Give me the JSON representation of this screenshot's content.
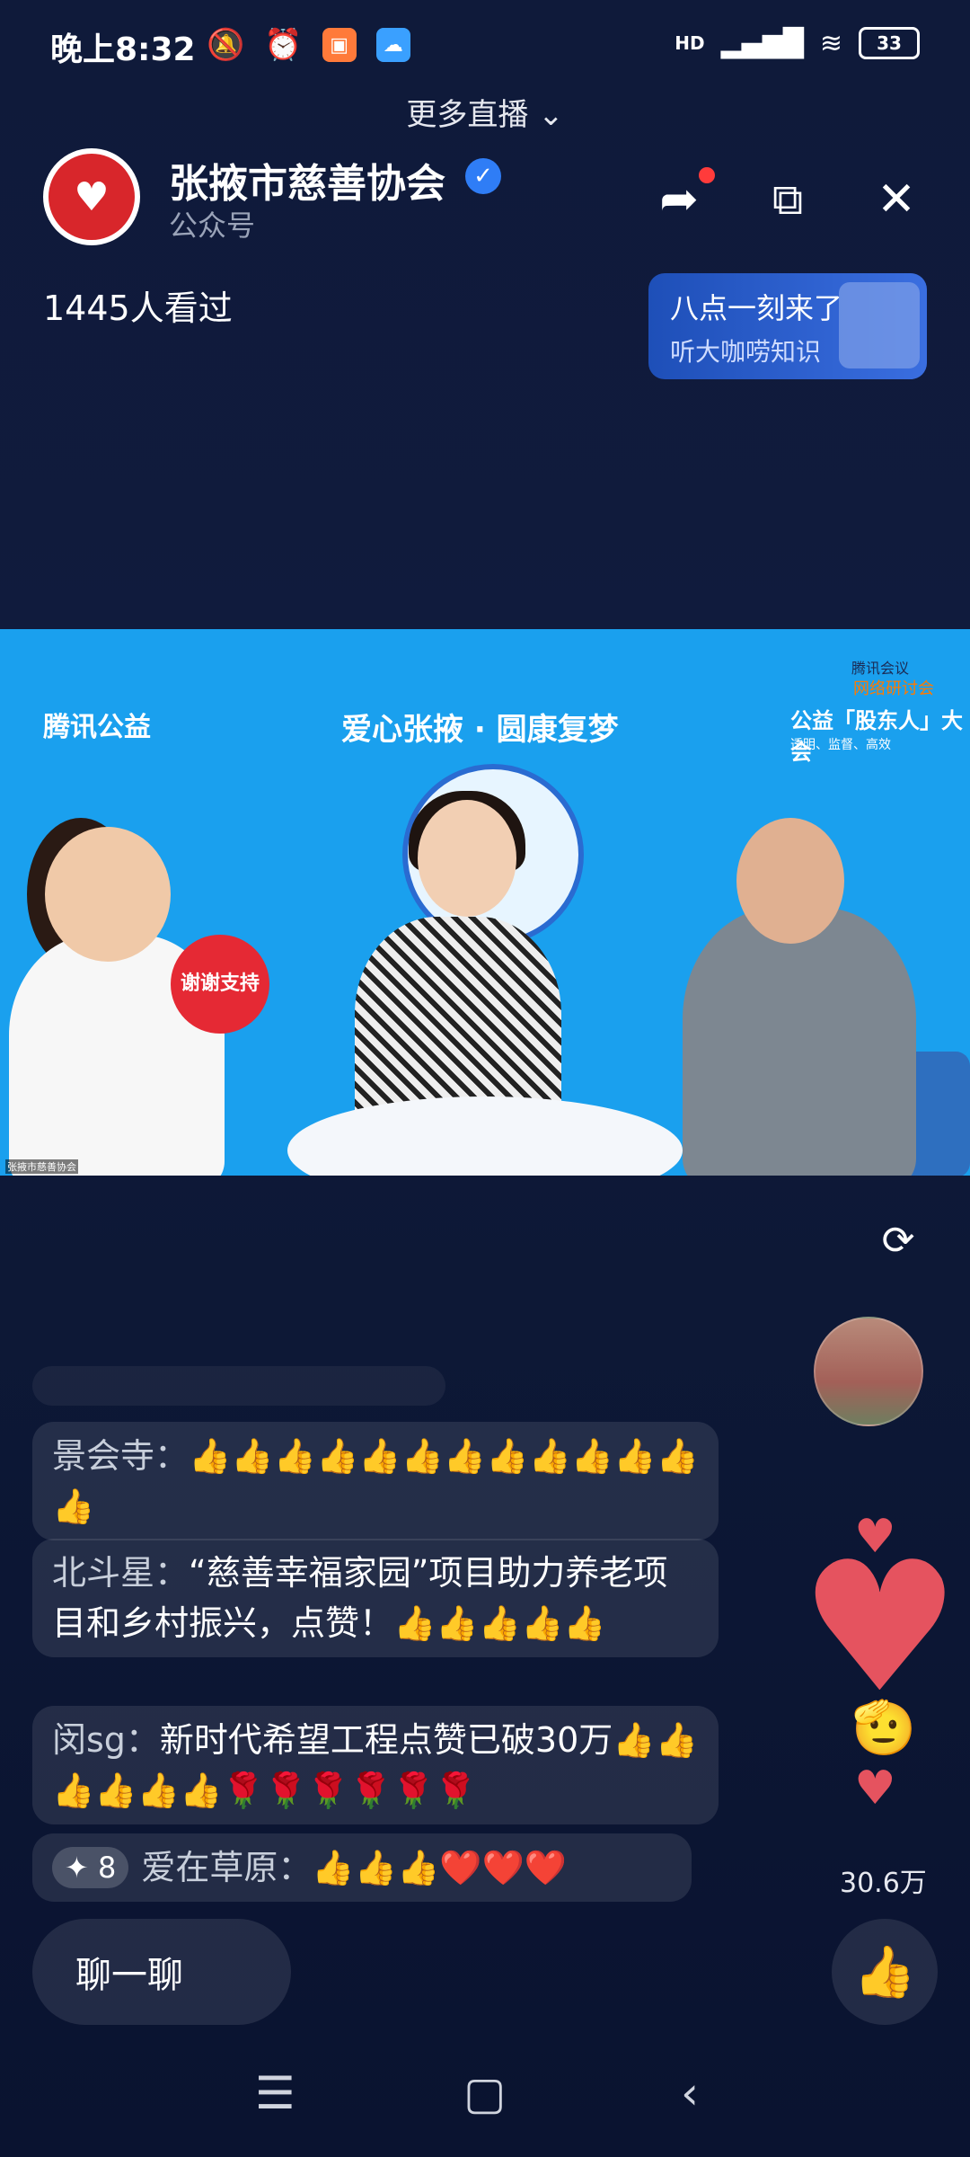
{
  "status_bar": {
    "time": "晚上8:32",
    "battery": "33",
    "signal_label": "HD"
  },
  "top": {
    "more_live": "更多直播"
  },
  "header": {
    "account_name": "张掖市慈善协会",
    "account_type": "公众号",
    "viewers": "1445人看过"
  },
  "promo": {
    "title": "八点一刻来了",
    "subtitle": "听大咖唠知识"
  },
  "video": {
    "brand": "腾讯公益",
    "slogan": "爱心张掖 · 圆康复梦",
    "right_top": "腾讯会议",
    "right_sub": "网络研讨会",
    "right_big": "公益「股东人」大会",
    "right_small": "透明、监督、高效",
    "sign_text": "谢谢支持",
    "watermark": "张掖市慈善协会"
  },
  "comments": [
    {
      "name": "景会寺：",
      "text": "👍👍👍👍👍👍👍👍👍👍👍👍👍"
    },
    {
      "name": "北斗星：",
      "text": "“慈善幸福家园”项目助力养老项目和乡村振兴，点赞！👍👍👍👍👍"
    },
    {
      "name": "闵sg：",
      "text": "新时代希望工程点赞已破30万👍👍👍👍👍👍🌹🌹🌹🌹🌹🌹"
    },
    {
      "badge": "✦ 8",
      "name": "爱在草原：",
      "text": "👍👍👍❤️❤️❤️"
    }
  ],
  "side": {
    "likes_count": "30.6万"
  },
  "bottom": {
    "chat_label": "聊一聊"
  },
  "icons": {
    "share": "share-icon",
    "pip": "picture-in-picture-icon",
    "close": "close-icon",
    "rotate": "rotate-icon",
    "like": "thumbs-up-icon"
  },
  "colors": {
    "background": "#0f1a3a",
    "accent_red": "#d8262b",
    "verified_blue": "#2f7df6",
    "video_blue": "#1aa0ee"
  }
}
